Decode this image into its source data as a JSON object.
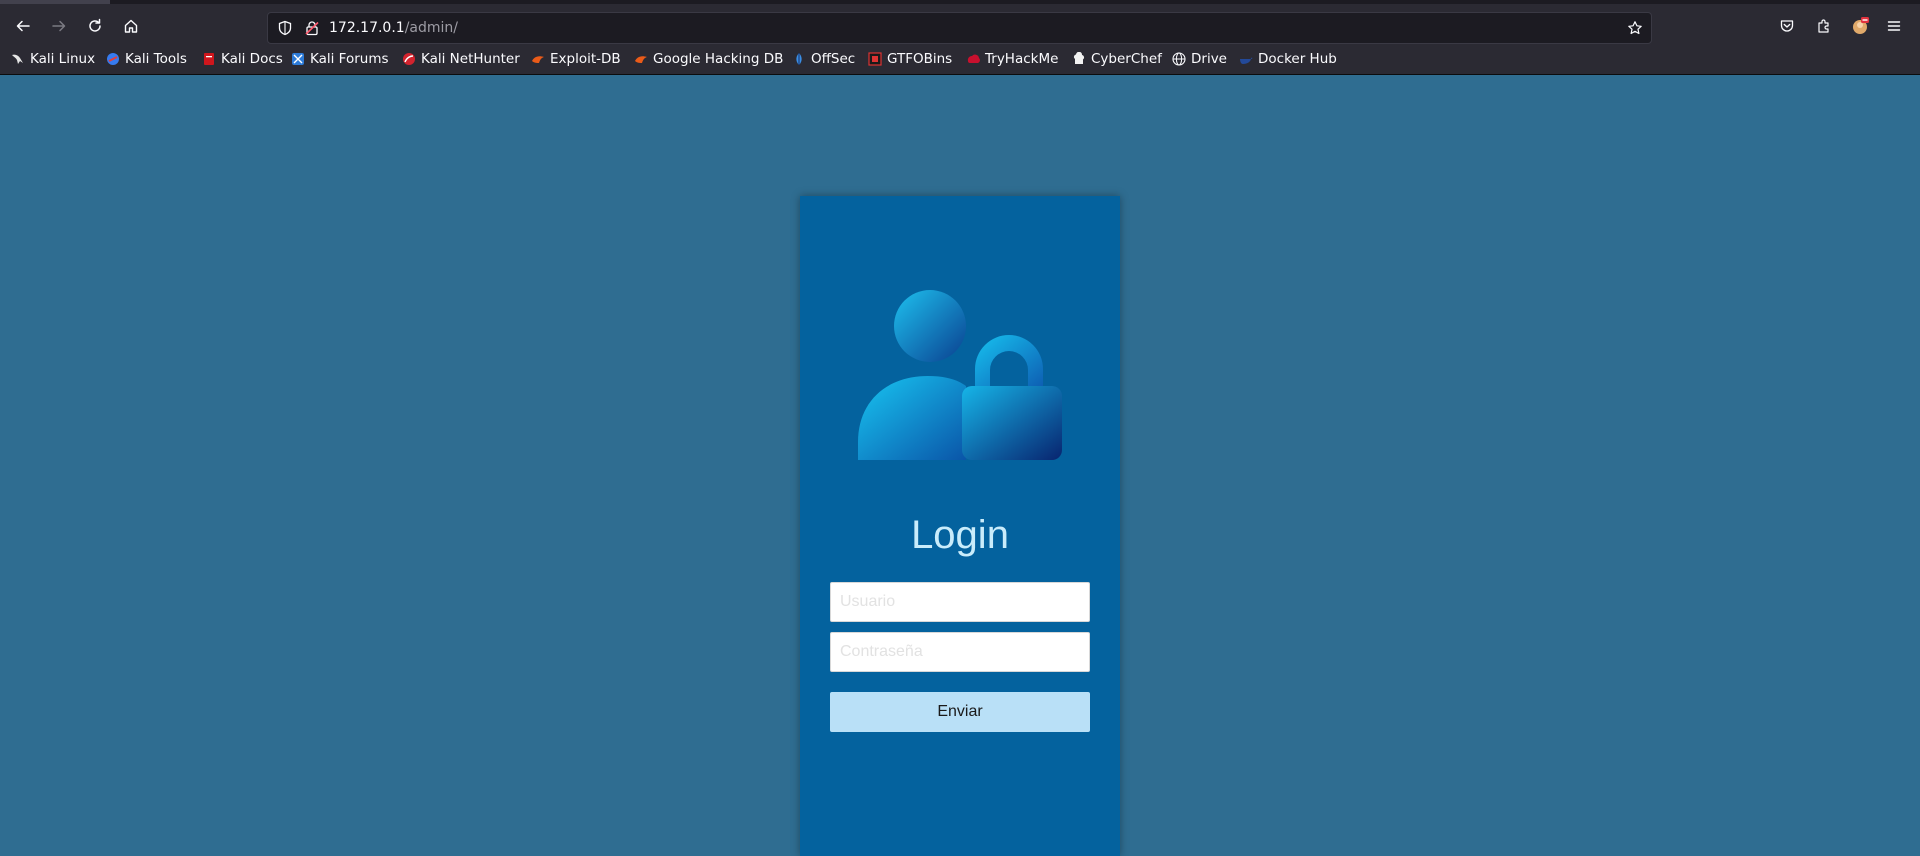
{
  "browser": {
    "url_host": "172.17.0.1",
    "url_path": "/admin/",
    "bookmarks": [
      {
        "label": "Kali Linux",
        "icon": "kali-dragon-icon"
      },
      {
        "label": "Kali Tools",
        "icon": "kali-tools-icon"
      },
      {
        "label": "Kali Docs",
        "icon": "kali-docs-icon"
      },
      {
        "label": "Kali Forums",
        "icon": "kali-forums-icon"
      },
      {
        "label": "Kali NetHunter",
        "icon": "kali-nethunter-icon"
      },
      {
        "label": "Exploit-DB",
        "icon": "exploit-db-icon"
      },
      {
        "label": "Google Hacking DB",
        "icon": "ghdb-icon"
      },
      {
        "label": "OffSec",
        "icon": "offsec-icon"
      },
      {
        "label": "GTFOBins",
        "icon": "gtfobins-icon"
      },
      {
        "label": "TryHackMe",
        "icon": "tryhackme-icon"
      },
      {
        "label": "CyberChef",
        "icon": "cyberchef-icon"
      },
      {
        "label": "Drive",
        "icon": "globe-icon"
      },
      {
        "label": "Docker Hub",
        "icon": "docker-icon"
      }
    ]
  },
  "login": {
    "title": "Login",
    "username_placeholder": "Usuario",
    "password_placeholder": "Contraseña",
    "submit_label": "Enviar"
  },
  "colors": {
    "page_background": "#2f6d91",
    "card_background": "#04629e",
    "title_color": "#c9ecfb",
    "button_background": "#b9e0f7"
  }
}
